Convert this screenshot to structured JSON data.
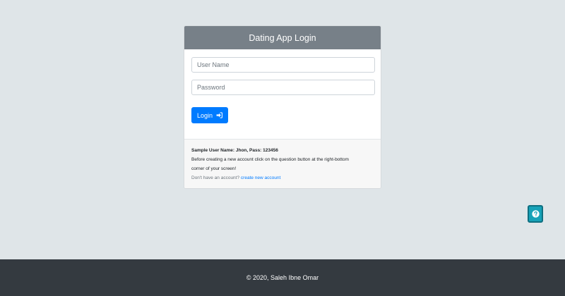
{
  "login_card": {
    "title": "Dating App Login",
    "username_placeholder": "User Name",
    "password_placeholder": "Password",
    "login_label": "Login",
    "login_icon": "sign-in-icon"
  },
  "info": {
    "sample_credentials": "Sample User Name: Jhon, Pass: 123456",
    "instructions_line1": "Before creating a new account click on the question button at the right-bottom",
    "instructions_line2": "corner of your screen!",
    "no_account_text": "Don't have an account?",
    "create_account_link": "create new account"
  },
  "help_button": {
    "icon": "question-circle-icon"
  },
  "footer": {
    "copyright": "© 2020, Saleh Ibne Omar"
  },
  "colors": {
    "background": "#dfe5e8",
    "header": "#778088",
    "primary": "#007bff",
    "help": "#17a2b8",
    "footer": "#343a40"
  }
}
